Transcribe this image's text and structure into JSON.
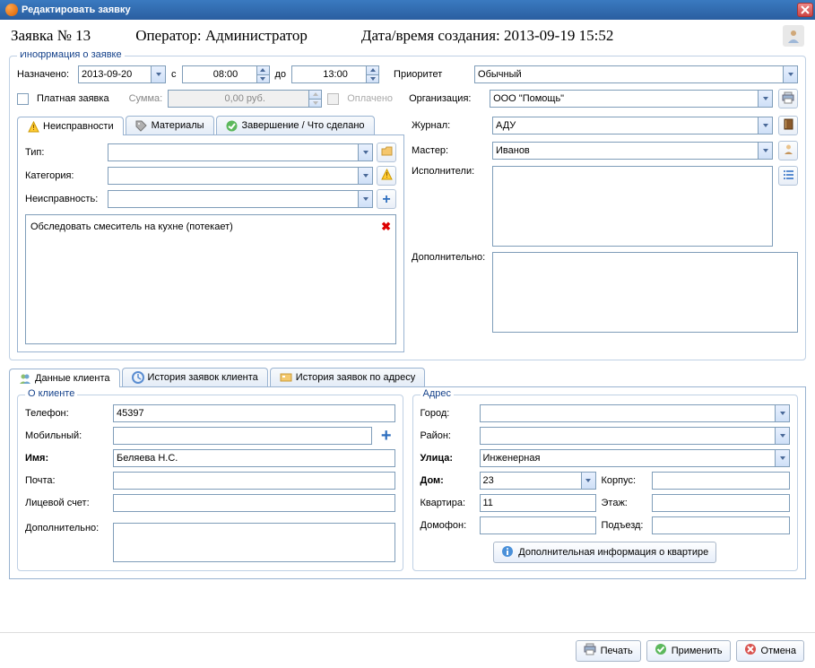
{
  "window_title": "Редактировать заявку",
  "header": {
    "request": "Заявка № 13",
    "operator": "Оператор: Администратор",
    "created": "Дата/время создания: 2013-09-19 15:52"
  },
  "request": {
    "legend": "Инофрмация о заявке",
    "assigned_label": "Назначено:",
    "assigned_date": "2013-09-20",
    "from_label": "с",
    "time_from": "08:00",
    "to_label": "до",
    "time_to": "13:00",
    "priority_label": "Приоритет",
    "priority": "Обычный",
    "paid_label": "Платная заявка",
    "sum_label": "Сумма:",
    "sum": "0,00 руб.",
    "paid_done_label": "Оплачено",
    "org_label": "Организация:",
    "org": "ООО \"Помощь\"",
    "journal_label": "Журнал:",
    "journal": "АДУ",
    "master_label": "Мастер:",
    "master": "Иванов",
    "executors_label": "Исполнители:",
    "additional_label": "Дополнительно:"
  },
  "defect_tabs": [
    {
      "label": "Неисправности"
    },
    {
      "label": "Материалы"
    },
    {
      "label": "Завершение / Что сделано"
    }
  ],
  "defect": {
    "type_label": "Тип:",
    "cat_label": "Категория:",
    "defect_label": "Неисправность:",
    "items": [
      {
        "text": "Обследовать смеситель на кухне (потекает)"
      }
    ]
  },
  "client_tabs": [
    {
      "label": "Данные клиента"
    },
    {
      "label": "История заявок клиента"
    },
    {
      "label": "История заявок по адресу"
    }
  ],
  "client": {
    "legend": "О клиенте",
    "phone_label": "Телефон:",
    "phone": "45397",
    "mobile_label": "Мобильный:",
    "mobile": "",
    "name_label": "Имя:",
    "name": "Беляева Н.С.",
    "email_label": "Почта:",
    "account_label": "Лицевой счет:",
    "additional_label": "Дополнительно:"
  },
  "address": {
    "legend": "Адрес",
    "city_label": "Город:",
    "district_label": "Район:",
    "street_label": "Улица:",
    "street": "Инженерная",
    "house_label": "Дом:",
    "house": "23",
    "korpus_label": "Корпус:",
    "apt_label": "Квартира:",
    "apt": "11",
    "floor_label": "Этаж:",
    "domofon_label": "Домофон:",
    "entrance_label": "Подъезд:",
    "info_btn": "Дополнительная информация о квартире"
  },
  "footer": {
    "print": "Печать",
    "apply": "Применить",
    "cancel": "Отмена"
  }
}
